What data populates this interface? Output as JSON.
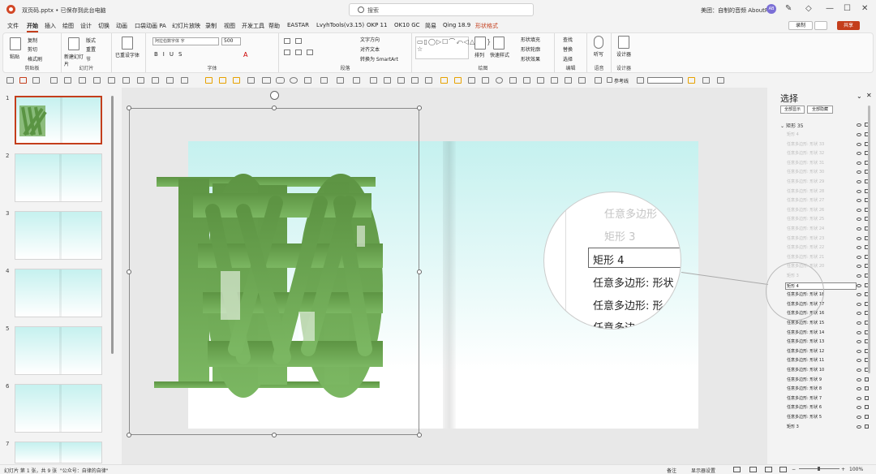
{
  "title_bar": {
    "filename": "双页码.pptx • 已保存到此台电脑",
    "search_placeholder": "搜索",
    "user": "美团：自制的音频 AboutPPT",
    "avatar": "AB"
  },
  "menu": {
    "tabs": [
      "文件",
      "开始",
      "插入",
      "绘图",
      "设计",
      "切换",
      "动画",
      "口袋动画 PA",
      "幻灯片放映",
      "录制",
      "视图",
      "开发工具",
      "帮助",
      "EASTAR",
      "LvyhTools(v3.15)",
      "OKP 11",
      "OK10 GC",
      "简易",
      "Qing 18.9",
      "形状格式"
    ]
  },
  "top_buttons": {
    "record": "录制",
    "share": "共享"
  },
  "ribbon": {
    "groups": [
      "剪贴板",
      "幻灯片",
      "字体",
      "段落",
      "绘图",
      "编辑",
      "语音",
      "设计器"
    ],
    "paste": "粘贴",
    "copy": "复制",
    "cut": "剪切",
    "format_painter": "格式刷",
    "new_slide": "新建幻灯片",
    "layout": "版式",
    "reset": "重置",
    "section": "节",
    "clear_format": "已重设字体",
    "font_name": "阿拉伯数字体 字",
    "font_size": "500",
    "text_direction": "文字方向",
    "align_text": "对齐文本",
    "smartart": "转换为 SmartArt",
    "arrange": "排列",
    "quick_styles": "快速样式",
    "shape_fill": "形状填充",
    "shape_outline": "形状轮廓",
    "shape_effects": "形状效果",
    "find": "查找",
    "replace": "替换",
    "select": "选择",
    "dictate": "听写",
    "designer": "设计器",
    "shape_gallery": "▭▯◯▷☐⌒⤺◁△⬡{}☆"
  },
  "qat": {
    "ref_line": "参考线"
  },
  "slides": {
    "numbers": [
      "1",
      "2",
      "3",
      "4",
      "5",
      "6",
      "7"
    ]
  },
  "selection_pane": {
    "title": "选择",
    "show_all": "全部显示",
    "hide_all": "全部隐藏",
    "group": "矩形 35",
    "items": [
      {
        "label": "矩形 4",
        "state": "dim"
      },
      {
        "label": "任意多边形: 形状 33",
        "state": "dim"
      },
      {
        "label": "任意多边形: 形状 32",
        "state": "dim"
      },
      {
        "label": "任意多边形: 形状 31",
        "state": "dim"
      },
      {
        "label": "任意多边形: 形状 30",
        "state": "dim"
      },
      {
        "label": "任意多边形: 形状 29",
        "state": "dim"
      },
      {
        "label": "任意多边形: 形状 28",
        "state": "dim"
      },
      {
        "label": "任意多边形: 形状 27",
        "state": "dim"
      },
      {
        "label": "任意多边形: 形状 26",
        "state": "dim"
      },
      {
        "label": "任意多边形: 形状 25",
        "state": "dim"
      },
      {
        "label": "任意多边形: 形状 24",
        "state": "dim"
      },
      {
        "label": "任意多边形: 形状 23",
        "state": "dim"
      },
      {
        "label": "任意多边形: 形状 22",
        "state": "dim"
      },
      {
        "label": "任意多边形: 形状 21",
        "state": "dim"
      },
      {
        "label": "任意多边形: 形状 20",
        "state": "dim"
      },
      {
        "label": "矩形 3",
        "state": "dim"
      },
      {
        "label": "矩形 4",
        "state": "selected"
      },
      {
        "label": "任意多边形: 形状 18",
        "state": "normal"
      },
      {
        "label": "任意多边形: 形状 17",
        "state": "normal"
      },
      {
        "label": "任意多边形: 形状 16",
        "state": "normal"
      },
      {
        "label": "任意多边形: 形状 15",
        "state": "normal"
      },
      {
        "label": "任意多边形: 形状 14",
        "state": "normal"
      },
      {
        "label": "任意多边形: 形状 13",
        "state": "normal"
      },
      {
        "label": "任意多边形: 形状 12",
        "state": "normal"
      },
      {
        "label": "任意多边形: 形状 11",
        "state": "normal"
      },
      {
        "label": "任意多边形: 形状 10",
        "state": "normal"
      },
      {
        "label": "任意多边形: 形状 9",
        "state": "normal"
      },
      {
        "label": "任意多边形: 形状 8",
        "state": "normal"
      },
      {
        "label": "任意多边形: 形状 7",
        "state": "normal"
      },
      {
        "label": "任意多边形: 形状 6",
        "state": "normal"
      },
      {
        "label": "任意多边形: 形状 5",
        "state": "normal"
      },
      {
        "label": "矩形 3",
        "state": "normal"
      }
    ]
  },
  "zoom_callout": {
    "lines": [
      "任意多边形",
      "矩形 3",
      "矩形 4",
      "任意多边形: 形状",
      "任意多边形: 形",
      "任意多边"
    ]
  },
  "status_bar": {
    "slide_info": "幻灯片 第 1 张，共 9 张",
    "account": "\"公众号：自律的自律\"",
    "notes": "备注",
    "display": "显示器设置",
    "zoom": "100%"
  },
  "colors": {
    "accent": "#c43e1c",
    "shape_green": "#6aa84f"
  }
}
